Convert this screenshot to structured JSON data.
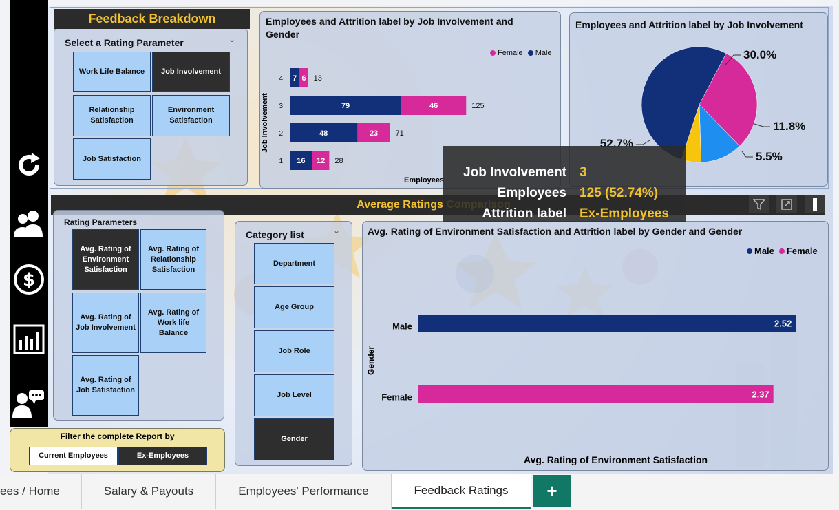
{
  "breakdown": {
    "header": "Feedback Breakdown",
    "select_title": "Select a Rating Parameter",
    "tiles": [
      "Work Life Balance",
      "Job Involvement",
      "Relationship Satisfaction",
      "Environment Satisfaction",
      "Job Satisfaction"
    ]
  },
  "chart1": {
    "title": "Employees and Attrition label by Job Involvement and Gender",
    "ylabel": "Job Involvement",
    "xlabel": "Employees",
    "legend": [
      "Female",
      "Male"
    ]
  },
  "chart2": {
    "title": "Employees and Attrition label by Job Involvement",
    "labels": [
      "30.0%",
      "11.8%",
      "5.5%",
      "52.7%"
    ]
  },
  "tooltip": {
    "k1": "Job Involvement",
    "v1": "3",
    "k2": "Employees",
    "v2": "125 (52.74%)",
    "k3": "Attrition label",
    "v3": "Ex-Employees"
  },
  "avg_section": {
    "header": "Average Ratings Comparison",
    "params_title": "Rating Parameters",
    "params": [
      "Avg. Rating of Environment Satisfaction",
      "Avg. Rating of Relationship Satisfaction",
      "Avg. Rating of Job Involvement",
      "Avg. Rating of Work life Balance",
      "Avg. Rating of Job Satisfaction"
    ],
    "category_title": "Category list",
    "categories": [
      "Department",
      "Age Group",
      "Job Role",
      "Job Level",
      "Gender"
    ]
  },
  "chart3": {
    "title": "Avg. Rating of Environment Satisfaction and Attrition label by Gender and Gender",
    "legend": [
      "Male",
      "Female"
    ],
    "ylabel": "Gender",
    "xlabel": "Avg. Rating of Environment Satisfaction"
  },
  "filter": {
    "title": "Filter the complete Report by",
    "current": "Current Employees",
    "ex": "Ex-Employees"
  },
  "tabs": [
    "ees / Home",
    "Salary & Payouts",
    "Employees' Performance",
    "Feedback Ratings",
    "+"
  ],
  "colors": {
    "male": "#12307a",
    "female": "#d62a9a",
    "accent": "#f2c12e",
    "teal": "#117865"
  },
  "chart_data": [
    {
      "type": "bar",
      "title": "Employees and Attrition label by Job Involvement and Gender",
      "xlabel": "Employees",
      "ylabel": "Job Involvement",
      "categories": [
        "4",
        "3",
        "2",
        "1"
      ],
      "series": [
        {
          "name": "Male",
          "values": [
            7,
            79,
            48,
            16
          ]
        },
        {
          "name": "Female",
          "values": [
            6,
            46,
            23,
            12
          ]
        }
      ],
      "totals": [
        13,
        125,
        71,
        28
      ]
    },
    {
      "type": "pie",
      "title": "Employees and Attrition label by Job Involvement",
      "slices": [
        {
          "label": "30.0%",
          "value": 30.0,
          "color": "#d62a9a"
        },
        {
          "label": "11.8%",
          "value": 11.8,
          "color": "#1e8ff0"
        },
        {
          "label": "5.5%",
          "value": 5.5,
          "color": "#f7c40e"
        },
        {
          "label": "52.7%",
          "value": 52.7,
          "color": "#12307a"
        }
      ]
    },
    {
      "type": "bar",
      "title": "Avg. Rating of Environment Satisfaction and Attrition label by Gender and Gender",
      "xlabel": "Avg. Rating of Environment Satisfaction",
      "ylabel": "Gender",
      "categories": [
        "Male",
        "Female"
      ],
      "values": [
        2.52,
        2.37
      ],
      "labels": [
        "2.52",
        "2.37"
      ]
    }
  ]
}
